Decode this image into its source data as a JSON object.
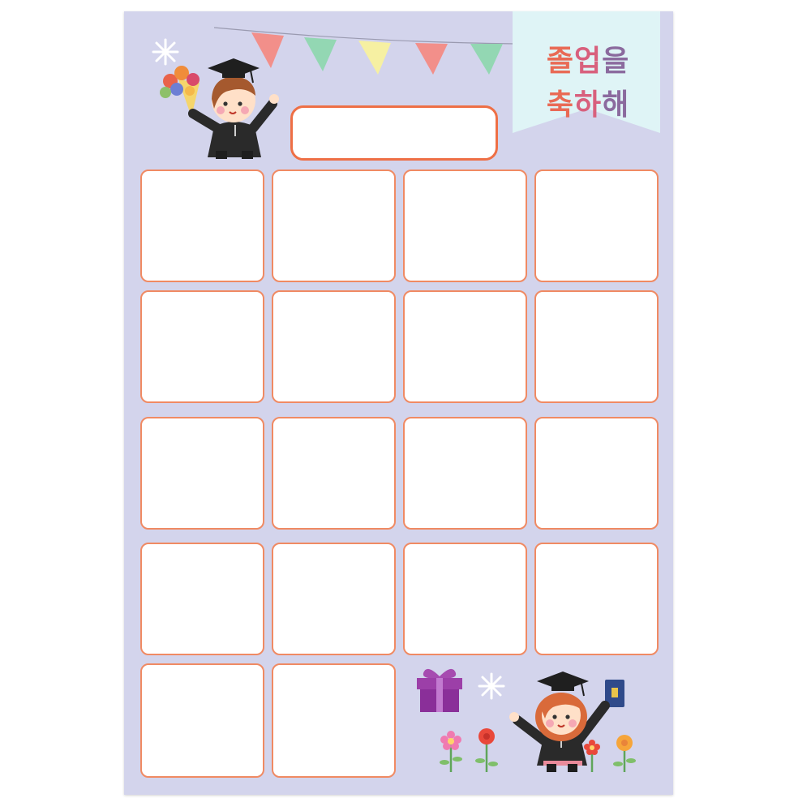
{
  "title": {
    "line1": [
      "졸",
      "업",
      "을"
    ],
    "line2": [
      "축",
      "하",
      "해"
    ]
  },
  "colors": {
    "background": "#d3d4ec",
    "slot_border": "#f08a63",
    "name_box_border": "#ee6f45",
    "banner": "#dff4f6",
    "title_orange": "#e96a55",
    "title_pink": "#d8607d",
    "title_purple": "#8b6a9e"
  },
  "pennants": [
    "#f28f8a",
    "#93d7b3",
    "#f6f0a2",
    "#f28f8a",
    "#93d7b3"
  ],
  "slots": {
    "rows": 5,
    "columns": 4,
    "count": 18
  },
  "illustrations": [
    "graduate-boy-icon",
    "graduate-girl-icon",
    "gift-box-icon",
    "bouquet-icon",
    "sparkle-icon",
    "flower-icon"
  ]
}
